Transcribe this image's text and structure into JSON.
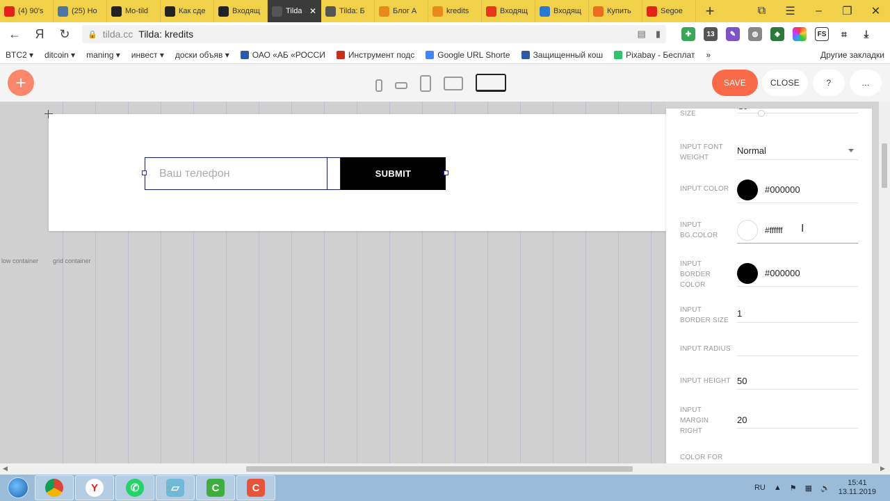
{
  "browser": {
    "tabs": [
      {
        "label": "(4) 90's",
        "icon": "youtube-icon",
        "color": "#e62117"
      },
      {
        "label": "(25) Но",
        "icon": "vk-icon",
        "color": "#4a76a8"
      },
      {
        "label": "Mo-tild",
        "icon": "tilda-icon",
        "color": "#222222"
      },
      {
        "label": "Как сде",
        "icon": "tilda-icon",
        "color": "#222222"
      },
      {
        "label": "Входящ",
        "icon": "kraken-icon",
        "color": "#222222"
      },
      {
        "label": "Tilda",
        "icon": "tilda-icon",
        "color": "#555555",
        "active": true
      },
      {
        "label": "Tilda: Б",
        "icon": "tilda-icon",
        "color": "#555555"
      },
      {
        "label": "Блог А",
        "icon": "crown-icon",
        "color": "#e8891b"
      },
      {
        "label": "kredits",
        "icon": "crown-icon",
        "color": "#e8891b"
      },
      {
        "label": "Входящ",
        "icon": "mail-icon",
        "color": "#e8351b"
      },
      {
        "label": "Входящ",
        "icon": "at-icon",
        "color": "#2a7ad5"
      },
      {
        "label": "Купить",
        "icon": "shop-icon",
        "color": "#ef6b1f"
      },
      {
        "label": "Segoe",
        "icon": "yandex-icon",
        "color": "#e62117"
      }
    ],
    "tab_close": "✕",
    "new_tab": "+",
    "address": {
      "host": "tilda.cc",
      "title": "Tilda: kredits"
    },
    "bookmarks": [
      {
        "label": "BTC2 ▾",
        "color": ""
      },
      {
        "label": "ditcoin ▾",
        "color": ""
      },
      {
        "label": "maning ▾",
        "color": ""
      },
      {
        "label": "инвест ▾",
        "color": ""
      },
      {
        "label": "доски объяв ▾",
        "color": ""
      },
      {
        "label": "ОАО «АБ «РОССИ",
        "color": "#2a5aa8"
      },
      {
        "label": "Инструмент подс",
        "color": "#c8301b"
      },
      {
        "label": "Google URL Shorte",
        "color": "#4285f4"
      },
      {
        "label": "Защищенный кош",
        "color": "#2a5aa8"
      },
      {
        "label": "Pixabay - Бесплат",
        "color": "#2ec66d"
      },
      {
        "label": "»",
        "color": ""
      }
    ],
    "bookmarks_other": "Другие закладки"
  },
  "editor": {
    "add_label": "+",
    "save_label": "SAVE",
    "close_label": "CLOSE",
    "help_label": "?",
    "more_label": "...",
    "form": {
      "input_placeholder": "Ваш телефон",
      "submit_label": "SUBMIT"
    },
    "canvas_labels": [
      "low container",
      "grid container"
    ]
  },
  "panel": {
    "size_label": "SIZE",
    "size_value": "16",
    "font_weight": {
      "label": "INPUT FONT WEIGHT",
      "value": "Normal"
    },
    "input_color": {
      "label": "INPUT COLOR",
      "value": "#000000"
    },
    "input_bg_color": {
      "label": "INPUT BG.COLOR",
      "value": "#ffffff"
    },
    "input_border_color": {
      "label": "INPUT BORDER COLOR",
      "value": "#000000"
    },
    "input_border_size": {
      "label": "INPUT BORDER SIZE",
      "value": "1"
    },
    "input_radius": {
      "label": "INPUT RADIUS",
      "value": ""
    },
    "input_height": {
      "label": "INPUT HEIGHT",
      "value": "50"
    },
    "input_margin_right": {
      "label": "INPUT MARGIN RIGHT",
      "value": "20"
    },
    "color_for": {
      "label": "COLOR FOR"
    }
  },
  "taskbar": {
    "lang": "RU",
    "time": "15:41",
    "date": "13.11.2019"
  },
  "colors": {
    "accent": "#fa6a48",
    "tab_strip": "#f1d04a",
    "submit_bg": "#000000"
  }
}
